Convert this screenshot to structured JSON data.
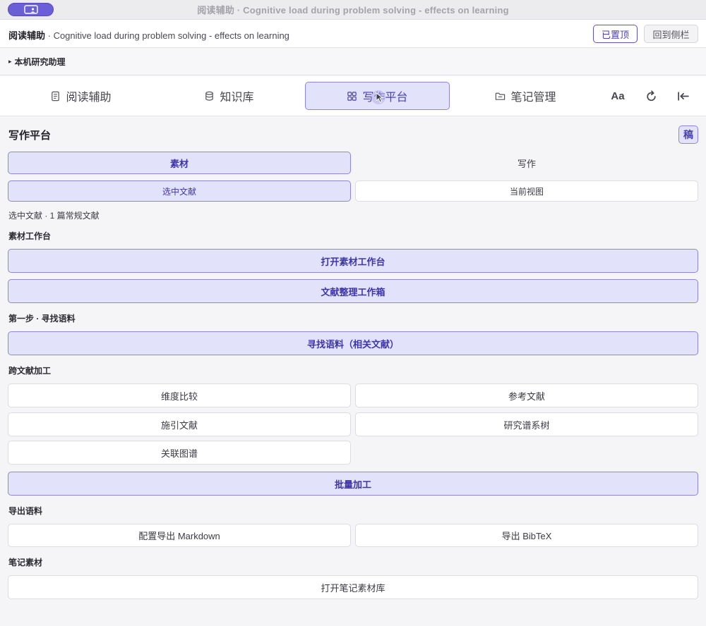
{
  "window": {
    "title": "阅读辅助 · Cognitive load during problem solving - effects on learning"
  },
  "header": {
    "app_name": "阅读辅助",
    "doc_title": " · Cognitive load during problem solving - effects on learning",
    "pinned_label": "已置顶",
    "back_sidebar_label": "回到侧栏"
  },
  "assistant": {
    "label": "本机研究助理"
  },
  "tabs": [
    {
      "label": "阅读辅助",
      "icon": "document-icon"
    },
    {
      "label": "知识库",
      "icon": "database-icon"
    },
    {
      "label": "写作平台",
      "icon": "grid-icon",
      "active": true
    },
    {
      "label": "笔记管理",
      "icon": "folder-icon"
    }
  ],
  "tools": {
    "font_size_label": "Aa",
    "refresh_icon": "refresh-icon",
    "collapse_icon": "collapse-left-icon"
  },
  "main": {
    "title": "写作平台",
    "draft_label": "稿",
    "mode_tabs": [
      "素材",
      "写作"
    ],
    "scope_tabs": [
      "选中文献",
      "当前视图"
    ],
    "scope_info": "选中文献 · 1 篇常规文献",
    "material_section": "素材工作台",
    "open_workbench": "打开素材工作台",
    "literature_toolbox": "文献整理工作箱",
    "step1_section": "第一步 · 寻找语料",
    "find_corpus": "寻找语料（相关文献）",
    "cross_section": "跨文献加工",
    "cross_buttons": [
      "维度比较",
      "参考文献",
      "施引文献",
      "研究谱系树",
      "关联图谱"
    ],
    "batch_process": "批量加工",
    "export_section": "导出语料",
    "export_markdown": "配置导出 Markdown",
    "export_bibtex": "导出 BibTeX",
    "notes_section": "笔记素材",
    "open_notes": "打开笔记素材库"
  }
}
